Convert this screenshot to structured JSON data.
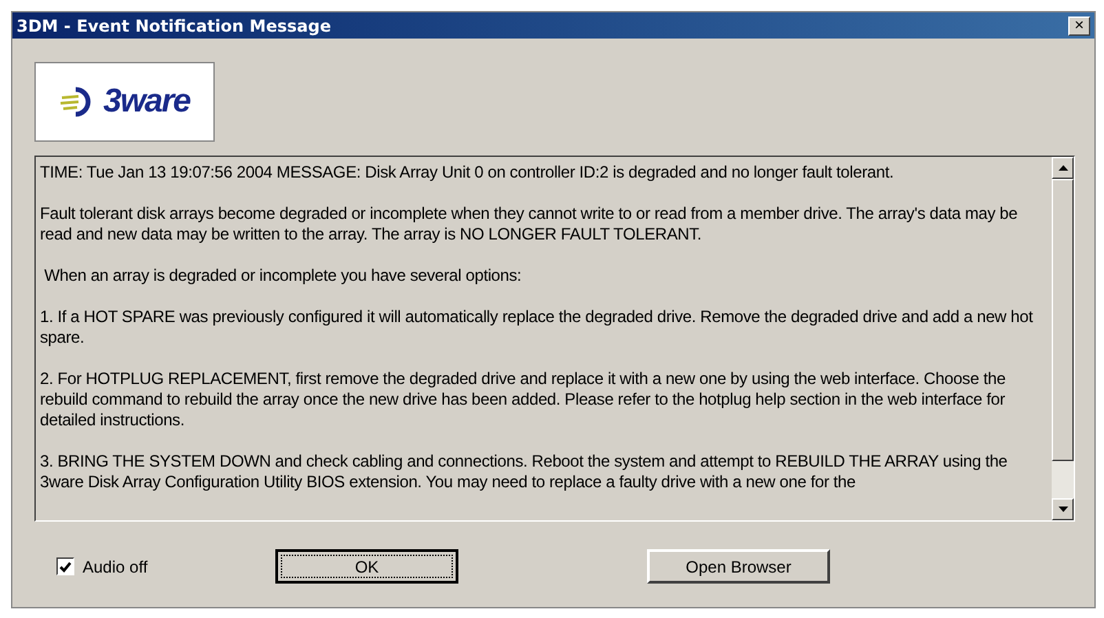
{
  "window": {
    "title": "3DM - Event Notification Message",
    "close_glyph": "×"
  },
  "logo": {
    "text": "3ware"
  },
  "message": {
    "paragraphs": [
      "TIME: Tue Jan 13 19:07:56 2004 MESSAGE: Disk Array Unit 0 on controller ID:2 is degraded and no longer fault tolerant.",
      "Fault tolerant disk arrays become degraded or incomplete when they cannot write to or read from a member drive. The array's data may be read and new data may be written to the array. The array is NO LONGER FAULT TOLERANT.",
      " When an array is degraded or incomplete you have several options:",
      "1. If a HOT SPARE was previously configured it will automatically replace the degraded drive. Remove the degraded drive and add a new hot spare.",
      "2. For HOTPLUG REPLACEMENT, first remove the degraded drive and replace it with a new one by using the web interface. Choose the rebuild command to rebuild the array once the new drive has been added. Please refer to the hotplug help section in the web interface for detailed instructions.",
      "3. BRING THE SYSTEM DOWN and check cabling and connections. Reboot the system and attempt to REBUILD THE ARRAY using the 3ware Disk Array Configuration Utility BIOS extension. You may need to replace a faulty drive with a new one for the"
    ]
  },
  "audio_off": {
    "label": "Audio off",
    "checked": true
  },
  "buttons": [
    {
      "label": "OK",
      "focused": true
    },
    {
      "label": "Open Browser",
      "focused": false
    }
  ]
}
